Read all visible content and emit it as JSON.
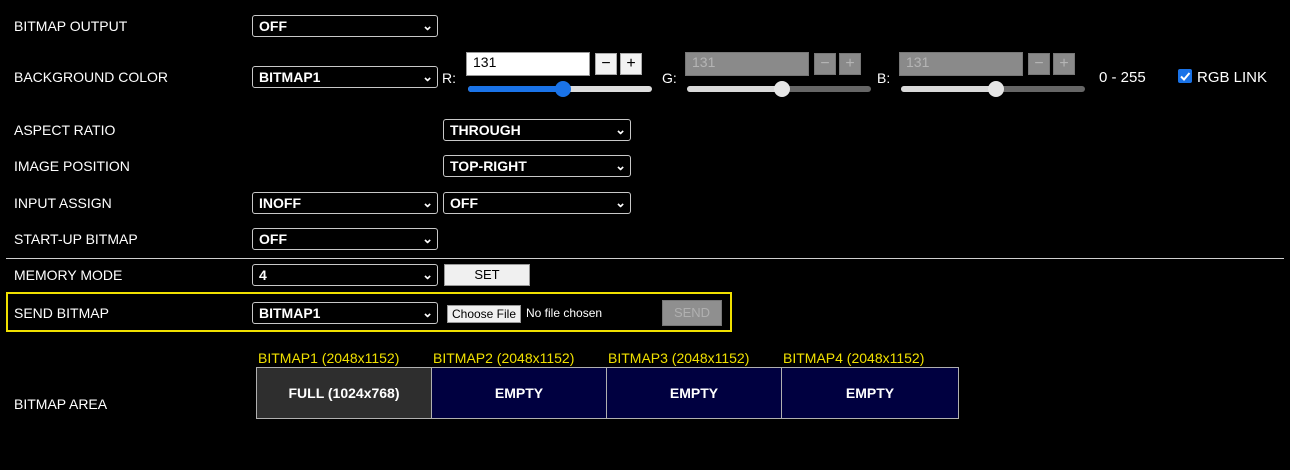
{
  "rows": {
    "bitmap_output": {
      "label": "BITMAP OUTPUT",
      "value": "OFF"
    },
    "background_color": {
      "label": "BACKGROUND COLOR",
      "value": "BITMAP1"
    },
    "aspect_ratio": {
      "label": "ASPECT RATIO",
      "value": "THROUGH"
    },
    "image_position": {
      "label": "IMAGE POSITION",
      "value": "TOP-RIGHT"
    },
    "input_assign": {
      "label": "INPUT ASSIGN",
      "value1": "INOFF",
      "value2": "OFF"
    },
    "startup_bitmap": {
      "label": "START-UP BITMAP",
      "value": "OFF"
    },
    "memory_mode": {
      "label": "MEMORY MODE",
      "value": "4",
      "button": "SET"
    },
    "send_bitmap": {
      "label": "SEND BITMAP",
      "value": "BITMAP1",
      "choose_file": "Choose File",
      "file_status": "No file chosen",
      "send": "SEND"
    },
    "bitmap_area": {
      "label": "BITMAP AREA"
    }
  },
  "rgb": {
    "r": {
      "label": "R:",
      "value": "131",
      "level": 0.514
    },
    "g": {
      "label": "G:",
      "value": "131",
      "level": 0.514
    },
    "b": {
      "label": "B:",
      "value": "131",
      "level": 0.514
    },
    "minus": "−",
    "plus": "+",
    "range": "0 - 255",
    "link_label": "RGB LINK",
    "link_checked": true
  },
  "bitmaps": [
    {
      "header": "BITMAP1 (2048x1152)",
      "cell": "FULL (1024x768)",
      "bg": "#2e2e2e"
    },
    {
      "header": "BITMAP2 (2048x1152)",
      "cell": "EMPTY",
      "bg": "#000040"
    },
    {
      "header": "BITMAP3 (2048x1152)",
      "cell": "EMPTY",
      "bg": "#000040"
    },
    {
      "header": "BITMAP4 (2048x1152)",
      "cell": "EMPTY",
      "bg": "#000040"
    }
  ],
  "colors": {
    "highlight_border": "#f0e000",
    "header_text": "#f0e000",
    "slider_accent": "#1a73e8"
  },
  "icons": {
    "dropdown": "chevron-down-icon",
    "checkbox": "checkbox-checked-icon"
  }
}
